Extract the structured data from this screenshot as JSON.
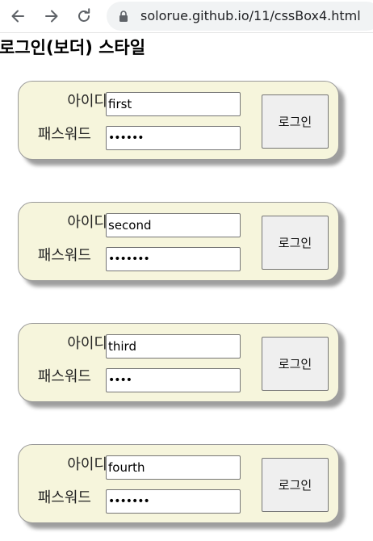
{
  "browser": {
    "url": "solorue.github.io/11/cssBox4.html",
    "back_icon": "arrow-left-icon",
    "forward_icon": "arrow-right-icon",
    "reload_icon": "reload-icon",
    "lock_icon": "lock-icon"
  },
  "page": {
    "title": "로그인(보더) 스타일"
  },
  "forms": [
    {
      "id_label": "아이디",
      "pw_label": "패스워드",
      "id_value": "first",
      "pw_masked": "••••••",
      "button": "로그인"
    },
    {
      "id_label": "아이디",
      "pw_label": "패스워드",
      "id_value": "second",
      "pw_masked": "•••••••",
      "button": "로그인"
    },
    {
      "id_label": "아이디",
      "pw_label": "패스워드",
      "id_value": "third",
      "pw_masked": "••••",
      "button": "로그인"
    },
    {
      "id_label": "아이디",
      "pw_label": "패스워드",
      "id_value": "fourth",
      "pw_masked": "•••••••",
      "button": "로그인"
    }
  ],
  "colors": {
    "box_background": "#f6f5dc",
    "box_border": "#9a9a9a",
    "shadow": "#9e9e9e",
    "button_background": "#efefef"
  }
}
